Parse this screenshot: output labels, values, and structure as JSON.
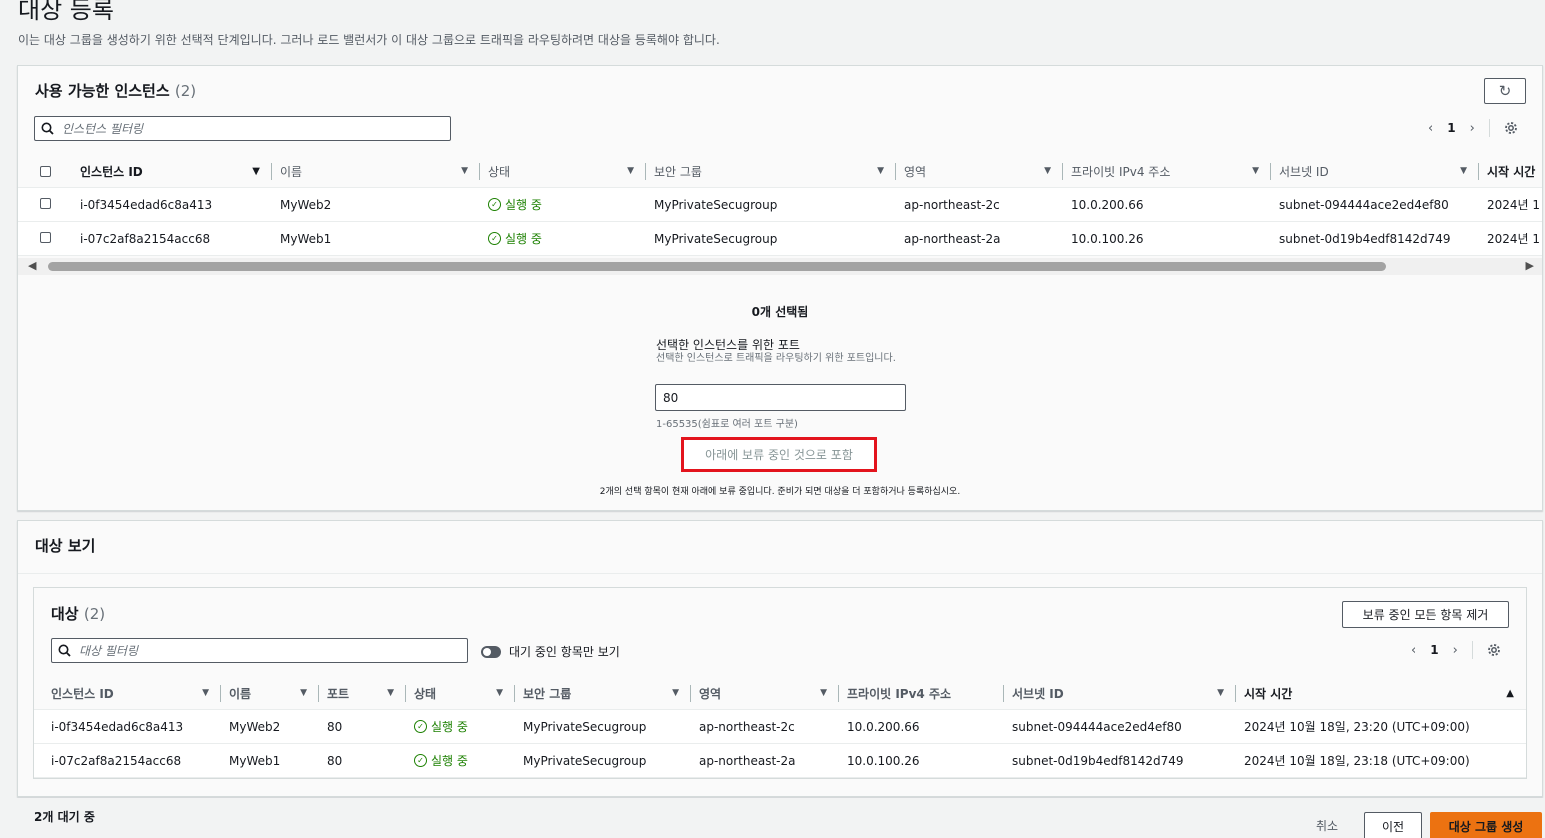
{
  "page": {
    "title": "대상 등록",
    "description": "이는 대상 그룹을 생성하기 위한 선택적 단계입니다. 그러나 로드 밸런서가 이 대상 그룹으로 트래픽을 라우팅하려면 대상을 등록해야 합니다."
  },
  "available": {
    "title": "사용 가능한 인스턴스",
    "count": "(2)",
    "filter_placeholder": "인스턴스 필터링",
    "page": "1",
    "columns": [
      "인스턴스 ID",
      "이름",
      "상태",
      "보안 그룹",
      "영역",
      "프라이빗 IPv4 주소",
      "서브넷 ID",
      "시작 시간"
    ],
    "rows": [
      {
        "id": "i-0f3454edad6c8a413",
        "name": "MyWeb2",
        "state": "실행 중",
        "sg": "MyPrivateSecugroup",
        "zone": "ap-northeast-2c",
        "ip": "10.0.200.66",
        "subnet": "subnet-094444ace2ed4ef80",
        "launch": "2024년 1"
      },
      {
        "id": "i-07c2af8a2154acc68",
        "name": "MyWeb1",
        "state": "실행 중",
        "sg": "MyPrivateSecugroup",
        "zone": "ap-northeast-2a",
        "ip": "10.0.100.26",
        "subnet": "subnet-0d19b4edf8142d749",
        "launch": "2024년 1"
      }
    ]
  },
  "selection": {
    "selected_count": "0개 선택됨",
    "port_label": "선택한 인스턴스를 위한 포트",
    "port_desc": "선택한 인스턴스로 트래픽을 라우팅하기 위한 포트입니다.",
    "port_value": "80",
    "port_hint": "1-65535(쉼표로 여러 포트 구분)",
    "include_button": "아래에 보류 중인 것으로 포함",
    "pending_note": "2개의 선택 항목이 현재 아래에 보류 중입니다. 준비가 되면 대상을 더 포함하거나 등록하십시오."
  },
  "review": {
    "title": "대상 보기",
    "targets_title": "대상",
    "targets_count": "(2)",
    "remove_all_button": "보류 중인 모든 항목 제거",
    "filter_placeholder": "대상 필터링",
    "toggle_label": "대기 중인 항목만 보기",
    "page": "1",
    "columns": [
      "인스턴스 ID",
      "이름",
      "포트",
      "상태",
      "보안 그룹",
      "영역",
      "프라이빗 IPv4 주소",
      "서브넷 ID",
      "시작 시간"
    ],
    "rows": [
      {
        "id": "i-0f3454edad6c8a413",
        "name": "MyWeb2",
        "port": "80",
        "state": "실행 중",
        "sg": "MyPrivateSecugroup",
        "zone": "ap-northeast-2c",
        "ip": "10.0.200.66",
        "subnet": "subnet-094444ace2ed4ef80",
        "launch": "2024년 10월 18일, 23:20 (UTC+09:00)"
      },
      {
        "id": "i-07c2af8a2154acc68",
        "name": "MyWeb1",
        "port": "80",
        "state": "실행 중",
        "sg": "MyPrivateSecugroup",
        "zone": "ap-northeast-2a",
        "ip": "10.0.100.26",
        "subnet": "subnet-0d19b4edf8142d749",
        "launch": "2024년 10월 18일, 23:18 (UTC+09:00)"
      }
    ]
  },
  "footer": {
    "pending_count": "2개 대기 중",
    "cancel": "취소",
    "previous": "이전",
    "create": "대상 그룹 생성"
  },
  "icons": {
    "refresh": "refresh-icon",
    "search": "search-icon",
    "settings": "gear-icon",
    "status_ok": "check-circle-icon"
  },
  "colors": {
    "primary_button": "#ec7211",
    "status_green": "#1d8102",
    "highlight_box": "#e3141d"
  }
}
